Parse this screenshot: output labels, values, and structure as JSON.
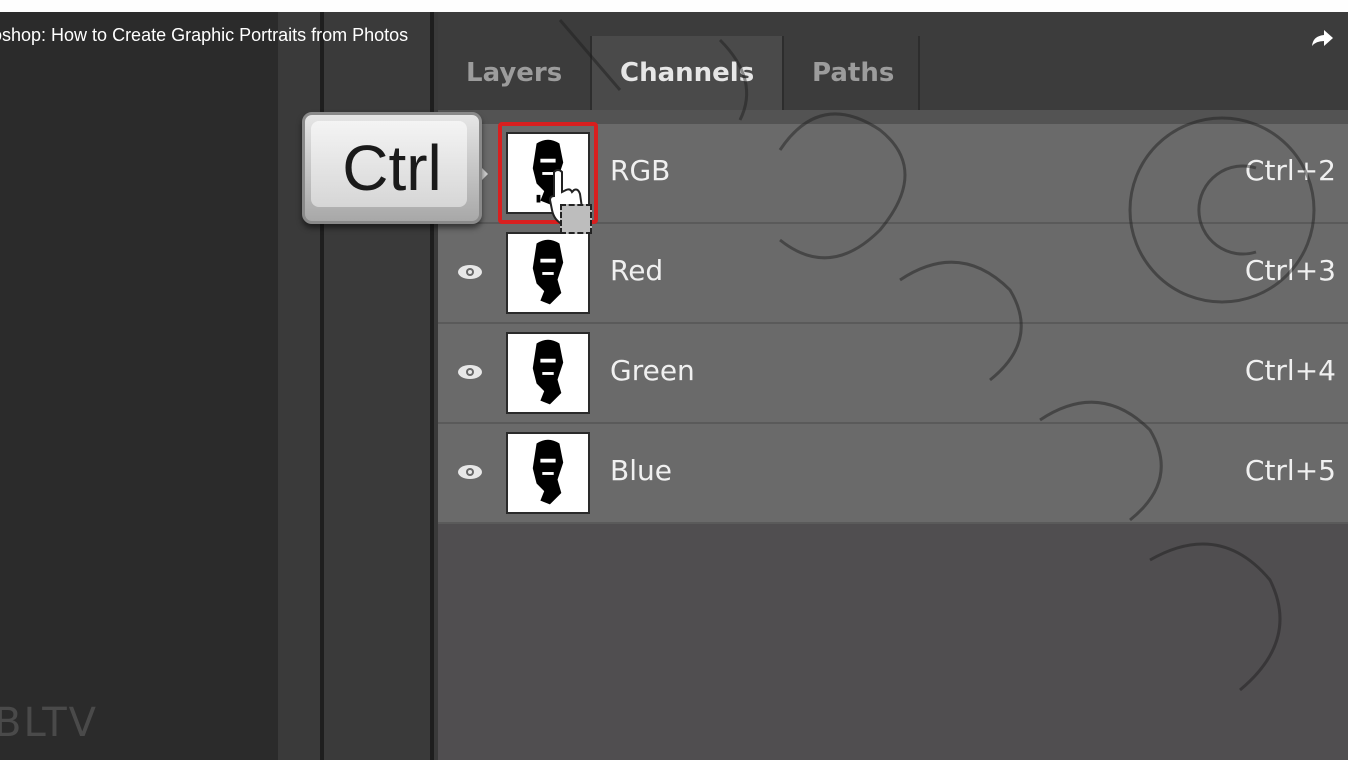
{
  "video": {
    "title": "oshop: How to Create Graphic Portraits from Photos",
    "share_icon": "share-arrow-icon"
  },
  "watermark": {
    "text": "BLTV"
  },
  "panel": {
    "tabs": [
      {
        "label": "Layers",
        "active": false
      },
      {
        "label": "Channels",
        "active": true
      },
      {
        "label": "Paths",
        "active": false
      }
    ],
    "channels": [
      {
        "name": "RGB",
        "shortcut": "Ctrl+2",
        "selected": true
      },
      {
        "name": "Red",
        "shortcut": "Ctrl+3",
        "selected": false
      },
      {
        "name": "Green",
        "shortcut": "Ctrl+4",
        "selected": false
      },
      {
        "name": "Blue",
        "shortcut": "Ctrl+5",
        "selected": false
      }
    ]
  },
  "overlay": {
    "key_label": "Ctrl"
  },
  "colors": {
    "selection_ring": "#d81f1f",
    "panel_bg": "#535353"
  }
}
